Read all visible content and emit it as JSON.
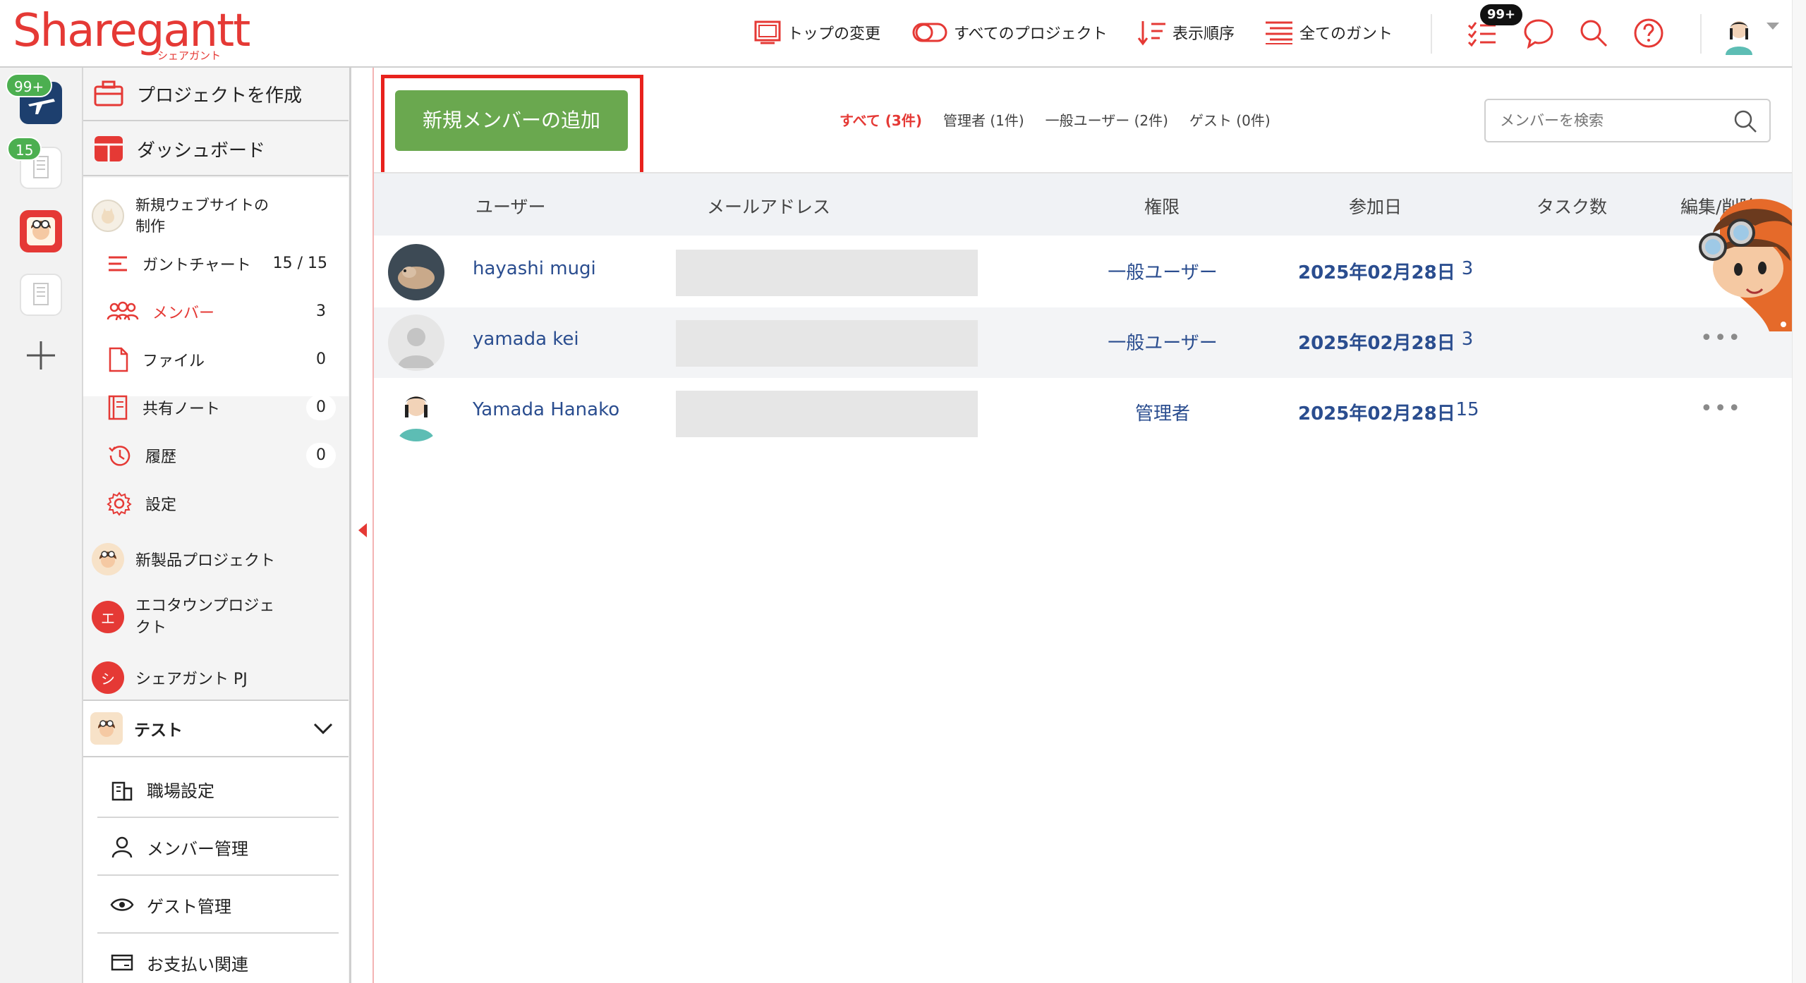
{
  "brand": {
    "name": "Sharegantt",
    "sub": "シェアガント"
  },
  "header": {
    "nav": [
      {
        "label": "トップの変更"
      },
      {
        "label": "すべてのプロジェクト"
      },
      {
        "label": "表示順序"
      },
      {
        "label": "全てのガント"
      }
    ],
    "notif_badge": "99+"
  },
  "rail": {
    "badge_top": "99+",
    "badge_second": "15"
  },
  "sidebar": {
    "create_project": "プロジェクトを作成",
    "dashboard": "ダッシュボード",
    "current_project": "新規ウェブサイトの制作",
    "current_project_line1": "新規ウェブサイトの",
    "current_project_line2": "制作",
    "menu": [
      {
        "label": "ガントチャート",
        "count": "15 / 15"
      },
      {
        "label": "メンバー",
        "count": "3"
      },
      {
        "label": "ファイル",
        "count": "0"
      },
      {
        "label": "共有ノート",
        "count": "0"
      },
      {
        "label": "履歴",
        "count": "0"
      },
      {
        "label": "設定",
        "count": ""
      }
    ],
    "projects": [
      {
        "name": "新製品プロジェクト",
        "initial": ""
      },
      {
        "name_line1": "エコタウンプロジェ",
        "name_line2": "クト",
        "initial": "エ"
      },
      {
        "name": "シェアガント PJ",
        "initial": "シ"
      }
    ],
    "workspace": "テスト",
    "workspace_menu": [
      {
        "label": "職場設定"
      },
      {
        "label": "メンバー管理"
      },
      {
        "label": "ゲスト管理"
      },
      {
        "label": "お支払い関連"
      }
    ]
  },
  "main": {
    "add_member_button": "新規メンバーの追加",
    "filters": [
      {
        "label": "すべて (3件)",
        "active": true
      },
      {
        "label": "管理者 (1件)"
      },
      {
        "label": "一般ユーザー (2件)"
      },
      {
        "label": "ゲスト (0件)"
      }
    ],
    "search_placeholder": "メンバーを検索",
    "columns": [
      "ユーザー",
      "メールアドレス",
      "権限",
      "参加日",
      "タスク数",
      "編集/削除"
    ],
    "rows": [
      {
        "name": "hayashi mugi",
        "role": "一般ユーザー",
        "joined": "2025年02月28日",
        "tasks": "3",
        "more": "•••"
      },
      {
        "name": "yamada kei",
        "role": "一般ユーザー",
        "joined": "2025年02月28日",
        "tasks": "3",
        "more": "•••"
      },
      {
        "name": "Yamada Hanako",
        "role": "管理者",
        "joined": "2025年02月28日",
        "tasks": "15",
        "more": "•••"
      }
    ]
  },
  "colors": {
    "accent": "#e53935",
    "button_green": "#6aa84f",
    "link_blue": "#2a4d8f",
    "badge_green": "#4caf50"
  }
}
